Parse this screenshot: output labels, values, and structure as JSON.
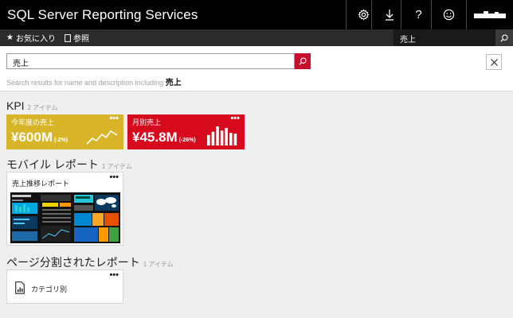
{
  "header": {
    "title": "SQL Server Reporting Services",
    "icons": [
      "gear-icon",
      "download-icon",
      "help-icon",
      "smiley-icon",
      "user-avatar"
    ]
  },
  "subnav": {
    "favorites": "お気に入り",
    "browse": "参照",
    "search_value": "売上"
  },
  "search": {
    "query": "売上",
    "note_prefix": "Search results for name and description including",
    "note_term": "売上"
  },
  "sections": {
    "kpi": {
      "title": "KPI",
      "count": "2 アイテム"
    },
    "mobile": {
      "title": "モバイル レポート",
      "count": "1 アイテム"
    },
    "paginated": {
      "title": "ページ分割されたレポート",
      "count": "1 アイテム"
    }
  },
  "kpis": [
    {
      "name": "今年度の売上",
      "value": "¥600M",
      "change": "(-2%)",
      "color": "#d8b429",
      "viz": "line"
    },
    {
      "name": "月別売上",
      "value": "¥45.8M",
      "change": "(-26%)",
      "color": "#d6091d",
      "viz": "bar",
      "bars": [
        0.55,
        0.72,
        1.0,
        0.78,
        0.92,
        0.66,
        0.62
      ]
    }
  ],
  "mobile_report": {
    "name": "売上推移レポート",
    "preview_label": "¥14.1M"
  },
  "paginated_report": {
    "name": "カテゴリ別"
  },
  "more_glyph": "•••"
}
